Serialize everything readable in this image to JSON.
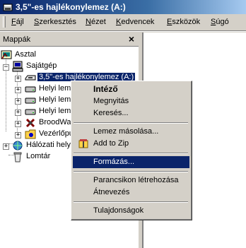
{
  "window": {
    "title": "3,5\"-es hajlékonylemez (A:)",
    "icon": "floppy-icon"
  },
  "menubar": {
    "items": [
      {
        "label": "Fájl"
      },
      {
        "label": "Szerkesztés"
      },
      {
        "label": "Nézet"
      },
      {
        "label": "Kedvencek"
      },
      {
        "label": "Eszközök"
      },
      {
        "label": "Súgó"
      }
    ]
  },
  "folders": {
    "header": "Mappák",
    "close": "×"
  },
  "tree": {
    "desktop": "Asztal",
    "mycomputer": "Sajátgép",
    "floppy": "3,5\"-es hajlékonylemez (A:)",
    "disk1": "Helyi lemez",
    "disk2": "Helyi lemez",
    "disk3": "Helyi lemez",
    "broodwar": "BroodWar",
    "controlpanel": "Vezérlőpult",
    "network": "Hálózati helyek",
    "recycle": "Lomtár"
  },
  "context_menu": {
    "open_explorer": "Intéző",
    "open": "Megnyitás",
    "search": "Keresés...",
    "copy_disk": "Lemez másolása...",
    "add_zip": "Add to Zip",
    "format": "Formázás...",
    "shortcut": "Parancsikon létrehozása",
    "rename": "Átnevezés",
    "properties": "Tulajdonságok"
  },
  "colors": {
    "titlebar": "#0a246a",
    "selection": "#0a246a",
    "face": "#d4d0c8"
  }
}
